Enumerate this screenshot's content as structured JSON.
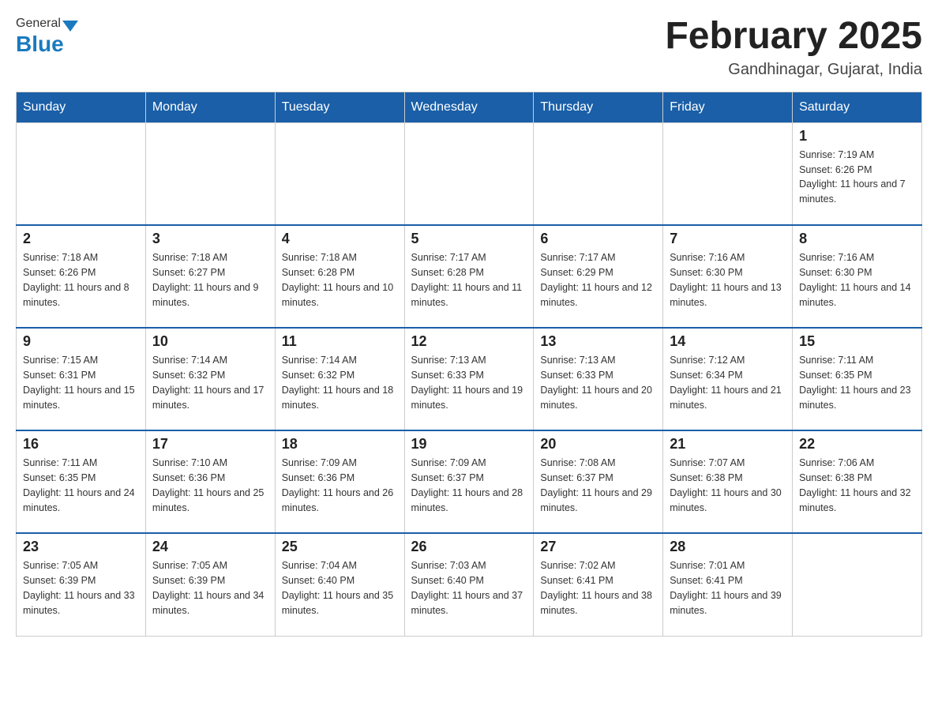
{
  "header": {
    "logo_general": "General",
    "logo_blue": "Blue",
    "month_title": "February 2025",
    "location": "Gandhinagar, Gujarat, India"
  },
  "weekdays": [
    "Sunday",
    "Monday",
    "Tuesday",
    "Wednesday",
    "Thursday",
    "Friday",
    "Saturday"
  ],
  "weeks": [
    [
      {
        "day": "",
        "info": ""
      },
      {
        "day": "",
        "info": ""
      },
      {
        "day": "",
        "info": ""
      },
      {
        "day": "",
        "info": ""
      },
      {
        "day": "",
        "info": ""
      },
      {
        "day": "",
        "info": ""
      },
      {
        "day": "1",
        "info": "Sunrise: 7:19 AM\nSunset: 6:26 PM\nDaylight: 11 hours and 7 minutes."
      }
    ],
    [
      {
        "day": "2",
        "info": "Sunrise: 7:18 AM\nSunset: 6:26 PM\nDaylight: 11 hours and 8 minutes."
      },
      {
        "day": "3",
        "info": "Sunrise: 7:18 AM\nSunset: 6:27 PM\nDaylight: 11 hours and 9 minutes."
      },
      {
        "day": "4",
        "info": "Sunrise: 7:18 AM\nSunset: 6:28 PM\nDaylight: 11 hours and 10 minutes."
      },
      {
        "day": "5",
        "info": "Sunrise: 7:17 AM\nSunset: 6:28 PM\nDaylight: 11 hours and 11 minutes."
      },
      {
        "day": "6",
        "info": "Sunrise: 7:17 AM\nSunset: 6:29 PM\nDaylight: 11 hours and 12 minutes."
      },
      {
        "day": "7",
        "info": "Sunrise: 7:16 AM\nSunset: 6:30 PM\nDaylight: 11 hours and 13 minutes."
      },
      {
        "day": "8",
        "info": "Sunrise: 7:16 AM\nSunset: 6:30 PM\nDaylight: 11 hours and 14 minutes."
      }
    ],
    [
      {
        "day": "9",
        "info": "Sunrise: 7:15 AM\nSunset: 6:31 PM\nDaylight: 11 hours and 15 minutes."
      },
      {
        "day": "10",
        "info": "Sunrise: 7:14 AM\nSunset: 6:32 PM\nDaylight: 11 hours and 17 minutes."
      },
      {
        "day": "11",
        "info": "Sunrise: 7:14 AM\nSunset: 6:32 PM\nDaylight: 11 hours and 18 minutes."
      },
      {
        "day": "12",
        "info": "Sunrise: 7:13 AM\nSunset: 6:33 PM\nDaylight: 11 hours and 19 minutes."
      },
      {
        "day": "13",
        "info": "Sunrise: 7:13 AM\nSunset: 6:33 PM\nDaylight: 11 hours and 20 minutes."
      },
      {
        "day": "14",
        "info": "Sunrise: 7:12 AM\nSunset: 6:34 PM\nDaylight: 11 hours and 21 minutes."
      },
      {
        "day": "15",
        "info": "Sunrise: 7:11 AM\nSunset: 6:35 PM\nDaylight: 11 hours and 23 minutes."
      }
    ],
    [
      {
        "day": "16",
        "info": "Sunrise: 7:11 AM\nSunset: 6:35 PM\nDaylight: 11 hours and 24 minutes."
      },
      {
        "day": "17",
        "info": "Sunrise: 7:10 AM\nSunset: 6:36 PM\nDaylight: 11 hours and 25 minutes."
      },
      {
        "day": "18",
        "info": "Sunrise: 7:09 AM\nSunset: 6:36 PM\nDaylight: 11 hours and 26 minutes."
      },
      {
        "day": "19",
        "info": "Sunrise: 7:09 AM\nSunset: 6:37 PM\nDaylight: 11 hours and 28 minutes."
      },
      {
        "day": "20",
        "info": "Sunrise: 7:08 AM\nSunset: 6:37 PM\nDaylight: 11 hours and 29 minutes."
      },
      {
        "day": "21",
        "info": "Sunrise: 7:07 AM\nSunset: 6:38 PM\nDaylight: 11 hours and 30 minutes."
      },
      {
        "day": "22",
        "info": "Sunrise: 7:06 AM\nSunset: 6:38 PM\nDaylight: 11 hours and 32 minutes."
      }
    ],
    [
      {
        "day": "23",
        "info": "Sunrise: 7:05 AM\nSunset: 6:39 PM\nDaylight: 11 hours and 33 minutes."
      },
      {
        "day": "24",
        "info": "Sunrise: 7:05 AM\nSunset: 6:39 PM\nDaylight: 11 hours and 34 minutes."
      },
      {
        "day": "25",
        "info": "Sunrise: 7:04 AM\nSunset: 6:40 PM\nDaylight: 11 hours and 35 minutes."
      },
      {
        "day": "26",
        "info": "Sunrise: 7:03 AM\nSunset: 6:40 PM\nDaylight: 11 hours and 37 minutes."
      },
      {
        "day": "27",
        "info": "Sunrise: 7:02 AM\nSunset: 6:41 PM\nDaylight: 11 hours and 38 minutes."
      },
      {
        "day": "28",
        "info": "Sunrise: 7:01 AM\nSunset: 6:41 PM\nDaylight: 11 hours and 39 minutes."
      },
      {
        "day": "",
        "info": ""
      }
    ]
  ]
}
